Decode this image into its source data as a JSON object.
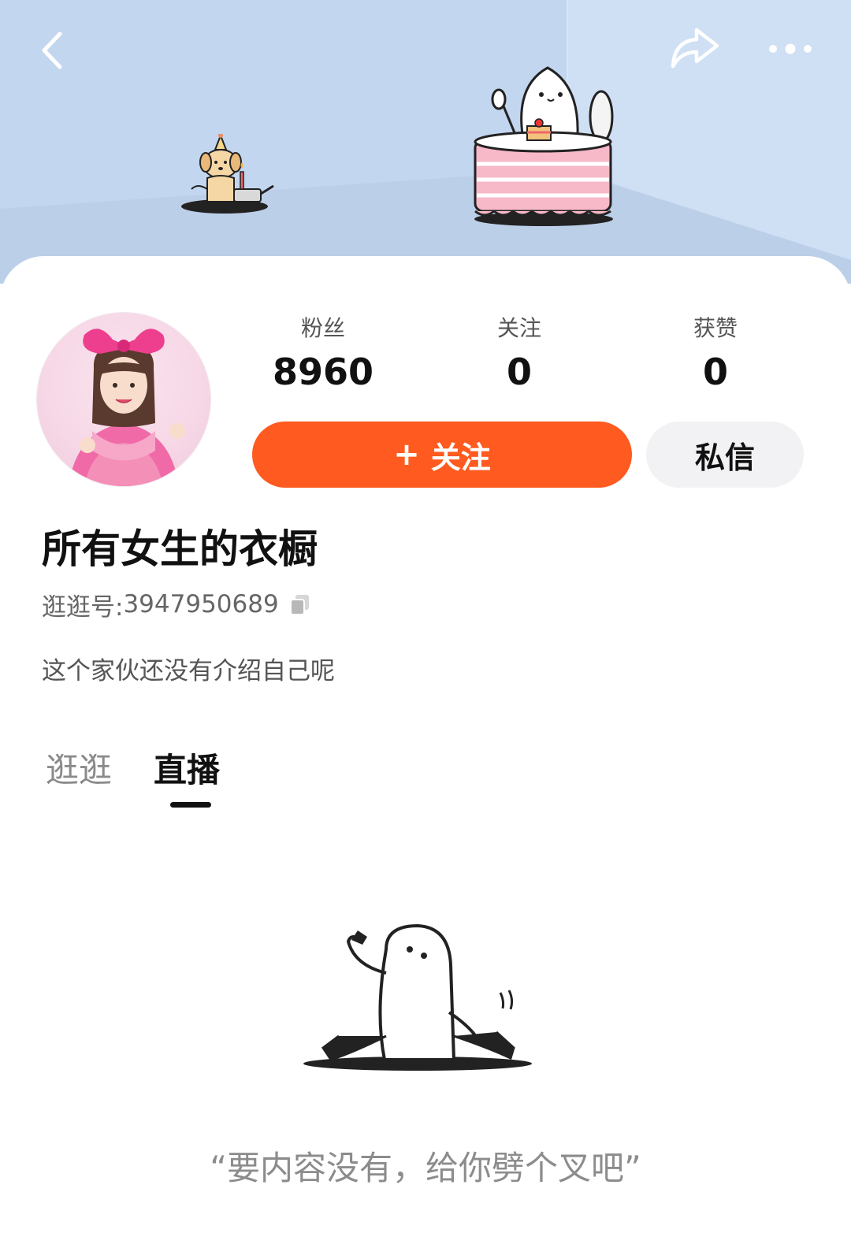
{
  "header": {
    "back_icon": "chevron-left-icon",
    "share_icon": "share-arrow-icon",
    "more_icon": "more-dots-icon"
  },
  "profile": {
    "name": "所有女生的衣橱",
    "id_label": "逛逛号: ",
    "id_value": "3947950689",
    "bio": "这个家伙还没有介绍自己呢"
  },
  "stats": [
    {
      "label": "粉丝",
      "value": "8960"
    },
    {
      "label": "关注",
      "value": "0"
    },
    {
      "label": "获赞",
      "value": "0"
    }
  ],
  "actions": {
    "follow_plus": "+",
    "follow_label": "关注",
    "message_label": "私信"
  },
  "tabs": {
    "items": [
      "逛逛",
      "直播"
    ],
    "active_index": 1
  },
  "empty_state": {
    "message": "“要内容没有，给你劈个叉吧”"
  },
  "colors": {
    "accent": "#ff5a1f",
    "banner": "#c9daf2"
  }
}
